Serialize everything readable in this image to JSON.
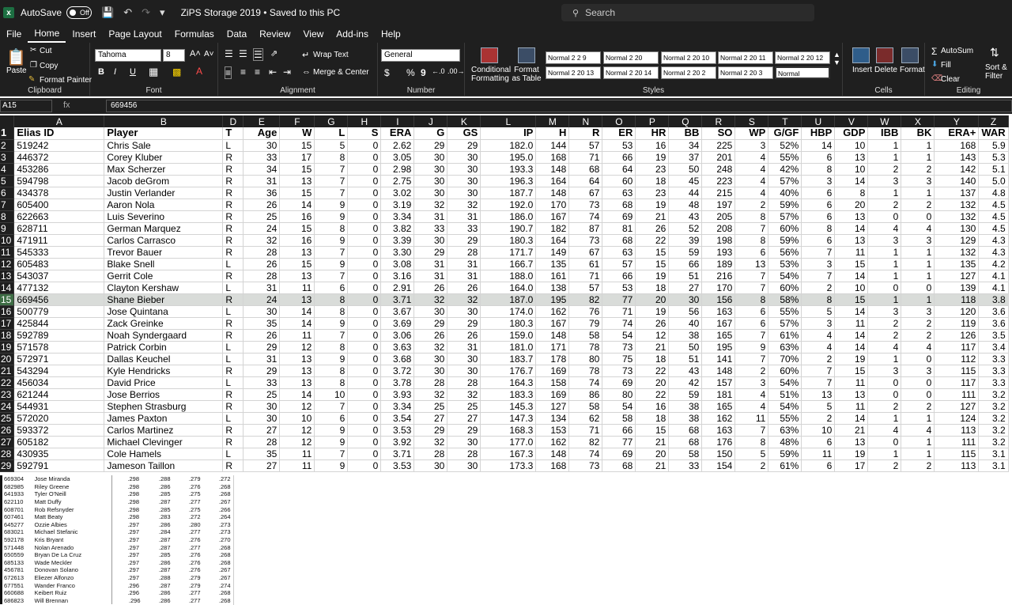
{
  "titlebar": {
    "autosave_label": "AutoSave",
    "autosave_state": "Off",
    "doc_title": "ZiPS Storage 2019 • Saved to this PC",
    "search_placeholder": "Search"
  },
  "menu": [
    "File",
    "Home",
    "Insert",
    "Page Layout",
    "Formulas",
    "Data",
    "Review",
    "View",
    "Add-ins",
    "Help"
  ],
  "ribbon": {
    "clipboard": {
      "paste": "Paste",
      "cut": "Cut",
      "copy": "Copy",
      "format_painter": "Format Painter",
      "label": "Clipboard"
    },
    "font": {
      "name": "Tahoma",
      "size": "8",
      "label": "Font",
      "bold": "B",
      "italic": "I",
      "underline": "U"
    },
    "alignment": {
      "wrap": "Wrap Text",
      "merge": "Merge & Center",
      "label": "Alignment"
    },
    "number": {
      "format": "General",
      "label": "Number",
      "currency": "$",
      "percent": "%",
      "comma": "9"
    },
    "conditional": "Conditional Formatting",
    "format_table": "Format as Table",
    "styles": {
      "label": "Styles",
      "cells": [
        "Normal 2 2 9",
        "Normal 2 20",
        "Normal 2 20 10",
        "Normal 2 20 11",
        "Normal 2 20 12",
        "Normal 2 20 13",
        "Normal 2 20 14",
        "Normal 2 20 2",
        "Normal 2 20 3",
        "Normal"
      ]
    },
    "cells": {
      "insert": "Insert",
      "delete": "Delete",
      "format": "Format",
      "label": "Cells"
    },
    "editing": {
      "autosum": "AutoSum",
      "fill": "Fill",
      "clear": "Clear",
      "sort": "Sort & Filter",
      "label": "Editing"
    }
  },
  "formula_bar": {
    "name_box": "A15",
    "fx": "fx",
    "value": "669456"
  },
  "grid": {
    "col_letters": [
      "A",
      "B",
      "D",
      "E",
      "F",
      "G",
      "H",
      "I",
      "J",
      "K",
      "L",
      "M",
      "N",
      "O",
      "P",
      "Q",
      "R",
      "S",
      "T",
      "U",
      "V",
      "W",
      "X",
      "Y",
      "Z"
    ],
    "header": [
      "Elias ID",
      "Player",
      "T",
      "Age",
      "W",
      "L",
      "S",
      "ERA",
      "G",
      "GS",
      "IP",
      "H",
      "R",
      "ER",
      "HR",
      "BB",
      "SO",
      "WP",
      "G/GF",
      "HBP",
      "GDP",
      "IBB",
      "BK",
      "ERA+",
      "WAR"
    ],
    "rows": [
      [
        "519242",
        "Chris Sale",
        "L",
        "30",
        "15",
        "5",
        "0",
        "2.62",
        "29",
        "29",
        "182.0",
        "144",
        "57",
        "53",
        "16",
        "34",
        "225",
        "3",
        "52%",
        "14",
        "10",
        "1",
        "1",
        "168",
        "5.9"
      ],
      [
        "446372",
        "Corey Kluber",
        "R",
        "33",
        "17",
        "8",
        "0",
        "3.05",
        "30",
        "30",
        "195.0",
        "168",
        "71",
        "66",
        "19",
        "37",
        "201",
        "4",
        "55%",
        "6",
        "13",
        "1",
        "1",
        "143",
        "5.3"
      ],
      [
        "453286",
        "Max Scherzer",
        "R",
        "34",
        "15",
        "7",
        "0",
        "2.98",
        "30",
        "30",
        "193.3",
        "148",
        "68",
        "64",
        "23",
        "50",
        "248",
        "4",
        "42%",
        "8",
        "10",
        "2",
        "2",
        "142",
        "5.1"
      ],
      [
        "594798",
        "Jacob deGrom",
        "R",
        "31",
        "13",
        "7",
        "0",
        "2.75",
        "30",
        "30",
        "196.3",
        "164",
        "64",
        "60",
        "18",
        "45",
        "223",
        "4",
        "57%",
        "3",
        "14",
        "3",
        "3",
        "140",
        "5.0"
      ],
      [
        "434378",
        "Justin Verlander",
        "R",
        "36",
        "15",
        "7",
        "0",
        "3.02",
        "30",
        "30",
        "187.7",
        "148",
        "67",
        "63",
        "23",
        "44",
        "215",
        "4",
        "40%",
        "6",
        "8",
        "1",
        "1",
        "137",
        "4.8"
      ],
      [
        "605400",
        "Aaron Nola",
        "R",
        "26",
        "14",
        "9",
        "0",
        "3.19",
        "32",
        "32",
        "192.0",
        "170",
        "73",
        "68",
        "19",
        "48",
        "197",
        "2",
        "59%",
        "6",
        "20",
        "2",
        "2",
        "132",
        "4.5"
      ],
      [
        "622663",
        "Luis Severino",
        "R",
        "25",
        "16",
        "9",
        "0",
        "3.34",
        "31",
        "31",
        "186.0",
        "167",
        "74",
        "69",
        "21",
        "43",
        "205",
        "8",
        "57%",
        "6",
        "13",
        "0",
        "0",
        "132",
        "4.5"
      ],
      [
        "628711",
        "German Marquez",
        "R",
        "24",
        "15",
        "8",
        "0",
        "3.82",
        "33",
        "33",
        "190.7",
        "182",
        "87",
        "81",
        "26",
        "52",
        "208",
        "7",
        "60%",
        "8",
        "14",
        "4",
        "4",
        "130",
        "4.5"
      ],
      [
        "471911",
        "Carlos Carrasco",
        "R",
        "32",
        "16",
        "9",
        "0",
        "3.39",
        "30",
        "29",
        "180.3",
        "164",
        "73",
        "68",
        "22",
        "39",
        "198",
        "8",
        "59%",
        "6",
        "13",
        "3",
        "3",
        "129",
        "4.3"
      ],
      [
        "545333",
        "Trevor Bauer",
        "R",
        "28",
        "13",
        "7",
        "0",
        "3.30",
        "29",
        "28",
        "171.7",
        "149",
        "67",
        "63",
        "15",
        "59",
        "193",
        "6",
        "56%",
        "7",
        "11",
        "1",
        "1",
        "132",
        "4.3"
      ],
      [
        "605483",
        "Blake Snell",
        "L",
        "26",
        "15",
        "9",
        "0",
        "3.08",
        "31",
        "31",
        "166.7",
        "135",
        "61",
        "57",
        "15",
        "66",
        "189",
        "13",
        "53%",
        "3",
        "15",
        "1",
        "1",
        "135",
        "4.2"
      ],
      [
        "543037",
        "Gerrit Cole",
        "R",
        "28",
        "13",
        "7",
        "0",
        "3.16",
        "31",
        "31",
        "188.0",
        "161",
        "71",
        "66",
        "19",
        "51",
        "216",
        "7",
        "54%",
        "7",
        "14",
        "1",
        "1",
        "127",
        "4.1"
      ],
      [
        "477132",
        "Clayton Kershaw",
        "L",
        "31",
        "11",
        "6",
        "0",
        "2.91",
        "26",
        "26",
        "164.0",
        "138",
        "57",
        "53",
        "18",
        "27",
        "170",
        "7",
        "60%",
        "2",
        "10",
        "0",
        "0",
        "139",
        "4.1"
      ],
      [
        "669456",
        "Shane Bieber",
        "R",
        "24",
        "13",
        "8",
        "0",
        "3.71",
        "32",
        "32",
        "187.0",
        "195",
        "82",
        "77",
        "20",
        "30",
        "156",
        "8",
        "58%",
        "8",
        "15",
        "1",
        "1",
        "118",
        "3.8"
      ],
      [
        "500779",
        "Jose Quintana",
        "L",
        "30",
        "14",
        "8",
        "0",
        "3.67",
        "30",
        "30",
        "174.0",
        "162",
        "76",
        "71",
        "19",
        "56",
        "163",
        "6",
        "55%",
        "5",
        "14",
        "3",
        "3",
        "120",
        "3.6"
      ],
      [
        "425844",
        "Zack Greinke",
        "R",
        "35",
        "14",
        "9",
        "0",
        "3.69",
        "29",
        "29",
        "180.3",
        "167",
        "79",
        "74",
        "26",
        "40",
        "167",
        "6",
        "57%",
        "3",
        "11",
        "2",
        "2",
        "119",
        "3.6"
      ],
      [
        "592789",
        "Noah Syndergaard",
        "R",
        "26",
        "11",
        "7",
        "0",
        "3.06",
        "26",
        "26",
        "159.0",
        "148",
        "58",
        "54",
        "12",
        "38",
        "165",
        "7",
        "61%",
        "4",
        "14",
        "2",
        "2",
        "126",
        "3.5"
      ],
      [
        "571578",
        "Patrick Corbin",
        "L",
        "29",
        "12",
        "8",
        "0",
        "3.63",
        "32",
        "31",
        "181.0",
        "171",
        "78",
        "73",
        "21",
        "50",
        "195",
        "9",
        "63%",
        "4",
        "14",
        "4",
        "4",
        "117",
        "3.4"
      ],
      [
        "572971",
        "Dallas Keuchel",
        "L",
        "31",
        "13",
        "9",
        "0",
        "3.68",
        "30",
        "30",
        "183.7",
        "178",
        "80",
        "75",
        "18",
        "51",
        "141",
        "7",
        "70%",
        "2",
        "19",
        "1",
        "0",
        "112",
        "3.3"
      ],
      [
        "543294",
        "Kyle Hendricks",
        "R",
        "29",
        "13",
        "8",
        "0",
        "3.72",
        "30",
        "30",
        "176.7",
        "169",
        "78",
        "73",
        "22",
        "43",
        "148",
        "2",
        "60%",
        "7",
        "15",
        "3",
        "3",
        "115",
        "3.3"
      ],
      [
        "456034",
        "David Price",
        "L",
        "33",
        "13",
        "8",
        "0",
        "3.78",
        "28",
        "28",
        "164.3",
        "158",
        "74",
        "69",
        "20",
        "42",
        "157",
        "3",
        "54%",
        "7",
        "11",
        "0",
        "0",
        "117",
        "3.3"
      ],
      [
        "621244",
        "Jose Berrios",
        "R",
        "25",
        "14",
        "10",
        "0",
        "3.93",
        "32",
        "32",
        "183.3",
        "169",
        "86",
        "80",
        "22",
        "59",
        "181",
        "4",
        "51%",
        "13",
        "13",
        "0",
        "0",
        "111",
        "3.2"
      ],
      [
        "544931",
        "Stephen Strasburg",
        "R",
        "30",
        "12",
        "7",
        "0",
        "3.34",
        "25",
        "25",
        "145.3",
        "127",
        "58",
        "54",
        "16",
        "38",
        "165",
        "4",
        "54%",
        "5",
        "11",
        "2",
        "2",
        "127",
        "3.2"
      ],
      [
        "572020",
        "James Paxton",
        "L",
        "30",
        "10",
        "6",
        "0",
        "3.54",
        "27",
        "27",
        "147.3",
        "134",
        "62",
        "58",
        "18",
        "38",
        "162",
        "11",
        "55%",
        "2",
        "14",
        "1",
        "1",
        "124",
        "3.2"
      ],
      [
        "593372",
        "Carlos Martinez",
        "R",
        "27",
        "12",
        "9",
        "0",
        "3.53",
        "29",
        "29",
        "168.3",
        "153",
        "71",
        "66",
        "15",
        "68",
        "163",
        "7",
        "63%",
        "10",
        "21",
        "4",
        "4",
        "113",
        "3.2"
      ],
      [
        "605182",
        "Michael Clevinger",
        "R",
        "28",
        "12",
        "9",
        "0",
        "3.92",
        "32",
        "30",
        "177.0",
        "162",
        "82",
        "77",
        "21",
        "68",
        "176",
        "8",
        "48%",
        "6",
        "13",
        "0",
        "1",
        "111",
        "3.2"
      ],
      [
        "430935",
        "Cole Hamels",
        "L",
        "35",
        "11",
        "7",
        "0",
        "3.71",
        "28",
        "28",
        "167.3",
        "148",
        "74",
        "69",
        "20",
        "58",
        "150",
        "5",
        "59%",
        "11",
        "19",
        "1",
        "1",
        "115",
        "3.1"
      ],
      [
        "592791",
        "Jameson Taillon",
        "R",
        "27",
        "11",
        "9",
        "0",
        "3.53",
        "30",
        "30",
        "173.3",
        "168",
        "73",
        "68",
        "21",
        "33",
        "154",
        "2",
        "61%",
        "6",
        "17",
        "2",
        "2",
        "113",
        "3.1"
      ]
    ]
  },
  "pasted_table": [
    [
      "669304",
      "Jose Miranda",
      ".298",
      ".288",
      ".279",
      ".272"
    ],
    [
      "682985",
      "Riley Greene",
      ".298",
      ".286",
      ".276",
      ".268"
    ],
    [
      "641933",
      "Tyler O'Neill",
      ".298",
      ".285",
      ".275",
      ".268"
    ],
    [
      "622110",
      "Matt Duffy",
      ".298",
      ".287",
      ".277",
      ".267"
    ],
    [
      "608701",
      "Rob Refsnyder",
      ".298",
      ".285",
      ".275",
      ".266"
    ],
    [
      "607461",
      "Matt Beaty",
      ".298",
      ".283",
      ".272",
      ".264"
    ],
    [
      "645277",
      "Ozzie Albies",
      ".297",
      ".286",
      ".280",
      ".273"
    ],
    [
      "683021",
      "Michael Stefanic",
      ".297",
      ".284",
      ".277",
      ".273"
    ],
    [
      "592178",
      "Kris Bryant",
      ".297",
      ".287",
      ".276",
      ".270"
    ],
    [
      "571448",
      "Nolan Arenado",
      ".297",
      ".287",
      ".277",
      ".268"
    ],
    [
      "650559",
      "Bryan De La Cruz",
      ".297",
      ".285",
      ".276",
      ".268"
    ],
    [
      "685133",
      "Wade Meckler",
      ".297",
      ".286",
      ".276",
      ".268"
    ],
    [
      "456781",
      "Donovan Solano",
      ".297",
      ".287",
      ".276",
      ".267"
    ],
    [
      "672613",
      "Eliezer Alfonzo",
      ".297",
      ".288",
      ".279",
      ".267"
    ],
    [
      "677551",
      "Wander Franco",
      ".296",
      ".287",
      ".279",
      ".274"
    ],
    [
      "660688",
      "Keibert Ruiz",
      ".296",
      ".286",
      ".277",
      ".268"
    ],
    [
      "686823",
      "Will Brennan",
      ".296",
      ".286",
      ".277",
      ".268"
    ]
  ]
}
